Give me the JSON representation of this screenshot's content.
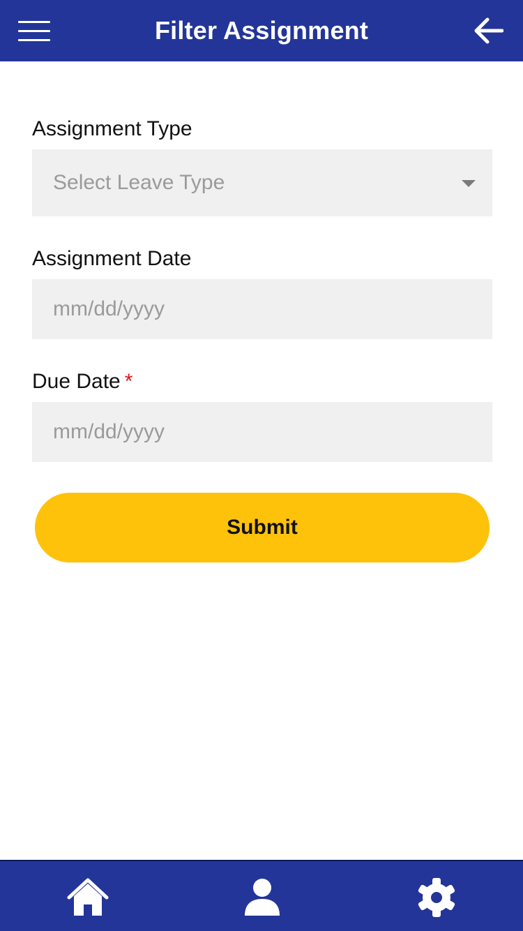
{
  "header": {
    "title": "Filter Assignment",
    "menu_icon": "hamburger-menu-icon",
    "back_icon": "arrow-left-icon",
    "background_color": "#233598"
  },
  "form": {
    "assignment_type": {
      "label": "Assignment Type",
      "placeholder": "Select Leave Type",
      "icon": "caret-down-icon"
    },
    "assignment_date": {
      "label": "Assignment Date",
      "placeholder": "mm/dd/yyyy"
    },
    "due_date": {
      "label": "Due Date",
      "required_marker": "*",
      "placeholder": "mm/dd/yyyy"
    },
    "submit_label": "Submit",
    "submit_color": "#fec20b"
  },
  "bottom_nav": {
    "items": [
      {
        "icon": "home-icon"
      },
      {
        "icon": "user-icon"
      },
      {
        "icon": "gear-icon"
      }
    ],
    "background_color": "#233598"
  }
}
